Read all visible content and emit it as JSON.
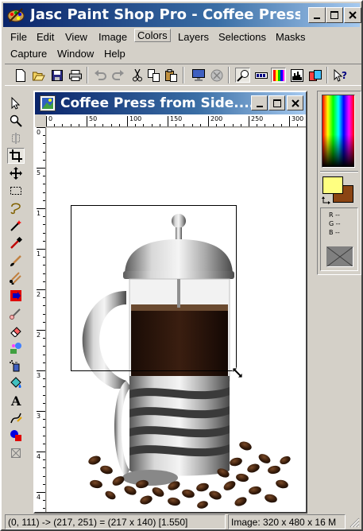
{
  "app": {
    "title": "Jasc Paint Shop Pro - Coffee Press fr..."
  },
  "menu": {
    "items": [
      {
        "label": "File",
        "key": "file"
      },
      {
        "label": "Edit",
        "key": "edit"
      },
      {
        "label": "View",
        "key": "view"
      },
      {
        "label": "Image",
        "key": "image"
      },
      {
        "label": "Colors",
        "key": "colors"
      },
      {
        "label": "Layers",
        "key": "layers"
      },
      {
        "label": "Selections",
        "key": "selections"
      },
      {
        "label": "Masks",
        "key": "masks"
      },
      {
        "label": "Capture",
        "key": "capture"
      },
      {
        "label": "Window",
        "key": "window"
      },
      {
        "label": "Help",
        "key": "help"
      }
    ],
    "active": "Colors"
  },
  "toolbar": {
    "buttons": [
      "new-icon",
      "open-icon",
      "save-icon",
      "print-icon",
      "undo-icon",
      "redo-icon",
      "cut-icon",
      "copy-icon",
      "paste-icon",
      "full-screen-preview-icon",
      "browse-icon",
      "zoom-overview-icon",
      "toolbar-toggle-icon",
      "color-palette-icon",
      "histogram-icon",
      "layer-palette-icon",
      "help-pointer-icon"
    ]
  },
  "tools": {
    "items": [
      "arrow-icon",
      "zoom-icon",
      "deformation-icon",
      "crop-icon",
      "mover-icon",
      "selection-icon",
      "freehand-selection-icon",
      "magic-wand-icon",
      "dropper-icon",
      "paint-brush-icon",
      "clone-brush-icon",
      "color-replacer-icon",
      "retouch-icon",
      "eraser-icon",
      "picture-tube-icon",
      "airbrush-icon",
      "flood-fill-icon",
      "text-icon",
      "draw-icon",
      "preset-shapes-icon",
      "object-selector-icon"
    ],
    "selected": "crop-icon"
  },
  "document": {
    "title": "Coffee Press from Side....",
    "ruler_h_labels": [
      "0",
      "50",
      "100",
      "150",
      "200",
      "250",
      "300"
    ],
    "ruler_v_labels": [
      "0",
      "5",
      "1",
      "1",
      "2",
      "2",
      "3",
      "3",
      "4",
      "4"
    ]
  },
  "colors": {
    "foreground": "#ffff80",
    "background": "#8b4513",
    "r_label": "R --",
    "g_label": "G --",
    "b_label": "B --",
    "titlebar_start": "#0a246a",
    "titlebar_end": "#a6caf0"
  },
  "status": {
    "coords": "(0, 111) -> (217, 251) = (217 x 140) [1.550]",
    "image_info": "Image:  320 x 480 x 16 M"
  }
}
